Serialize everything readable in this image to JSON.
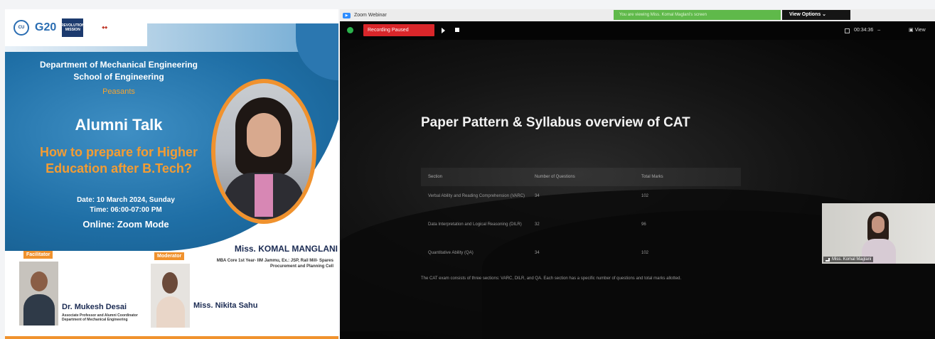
{
  "poster": {
    "logos": [
      "CU",
      "G20",
      "REVOLUTION MISSION",
      "ribbon"
    ],
    "department": "Department of Mechanical Engineering",
    "school": "School of Engineering",
    "presents": "Peasants",
    "talk_title": "Alumni Talk",
    "talk_subtitle_1": "How to prepare for Higher",
    "talk_subtitle_2": "Education after B.Tech?",
    "date": "Date: 10 March 2024, Sunday",
    "time": "Time: 06:00-07:00 PM",
    "mode": "Online: Zoom Mode",
    "speaker_name": "Miss. KOMAL MANGLANI",
    "speaker_desc": "MBA Core 1st Year- IIM Jammu, Ex.: JSP, Rail Mill- Spares Procurement and Planning Cell",
    "facilitator_tag": "Facilitator",
    "facilitator_name": "Dr. Mukesh Desai",
    "facilitator_desc_1": "Associate Professor and Alumni Coordinator",
    "facilitator_desc_2": "Department of Mechanical Engineering",
    "moderator_tag": "Moderator",
    "moderator_name": "Miss. Nikita Sahu"
  },
  "zoom": {
    "window_title": "Zoom Webinar",
    "viewing_banner": "You are viewing Miss. Komal Maglani's screen",
    "view_options": "View Options",
    "recording_status": "Recording Paused",
    "timer": "00:34:36",
    "view_label": "View",
    "slide_title": "Paper Pattern & Syllabus overview of CAT",
    "table_headers": [
      "Section",
      "Number of Questions",
      "Total Marks"
    ],
    "table_rows": [
      {
        "section": "Verbal Ability and Reading Comprehension (VARC)",
        "questions": "34",
        "marks": "102"
      },
      {
        "section": "Data Interpretation and Logical Reasoning (DILR)",
        "questions": "32",
        "marks": "96"
      },
      {
        "section": "Quantitative Ability (QA)",
        "questions": "34",
        "marks": "102"
      }
    ],
    "slide_note": "The CAT exam consists of three sections: VARC, DILR, and QA. Each section has a specific number of questions and total marks allotted.",
    "participant_name": "Miss. Komal Maglani"
  },
  "colors": {
    "accent_orange": "#f0922e",
    "poster_blue": "#1f6fa6",
    "record_red": "#d9262a",
    "banner_green": "#5fb94a"
  }
}
